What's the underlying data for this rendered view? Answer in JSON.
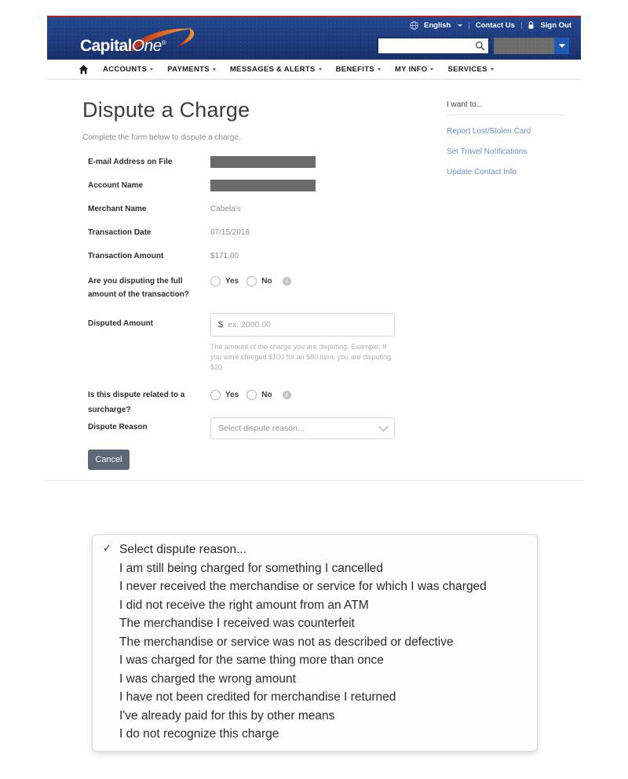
{
  "header": {
    "logo_text_1": "Capital",
    "logo_text_2": "One",
    "logo_reg": "®",
    "language": "English",
    "contact_us": "Contact Us",
    "sign_out": "Sign Out",
    "separator": "|",
    "search_placeholder": "",
    "search_value": "",
    "account_selector_value": ""
  },
  "nav": {
    "items": [
      {
        "label": "ACCOUNTS",
        "has_caret": true
      },
      {
        "label": "PAYMENTS",
        "has_caret": true
      },
      {
        "label": "MESSAGES & ALERTS",
        "has_caret": true
      },
      {
        "label": "BENEFITS",
        "has_caret": true
      },
      {
        "label": "MY INFO",
        "has_caret": true
      },
      {
        "label": "SERVICES",
        "has_caret": true
      }
    ]
  },
  "main": {
    "title": "Dispute a Charge",
    "subtitle": "Complete the form below to dispute a charge."
  },
  "i_want_to": {
    "title": "I want to...",
    "links": [
      "Report Lost/Stolen Card",
      "Set Travel Notifications",
      "Update Contact Info"
    ]
  },
  "form": {
    "email_label": "E-mail Address on File",
    "email_value": "",
    "account_name_label": "Account Name",
    "account_name_value": "",
    "merchant_label": "Merchant Name",
    "merchant_value": "Cabela's",
    "txn_date_label": "Transaction Date",
    "txn_date_value": "07/15/2016",
    "txn_amount_label": "Transaction Amount",
    "txn_amount_value": "$171.00",
    "full_amount_label": "Are you disputing the full amount of the transaction?",
    "yes_label": "Yes",
    "no_label": "No",
    "disputed_amount_label": "Disputed Amount",
    "disputed_amount_currency": "$",
    "disputed_amount_placeholder": "ex. 2000.00",
    "disputed_amount_value": "",
    "disputed_amount_help": "The amount of the charge you are disputing. Example: If you were charged $100 for an $80 item, you are disputing $20.",
    "surcharge_label": "Is this dispute related to a surcharge?",
    "dispute_reason_label": "Dispute Reason",
    "dispute_reason_selected": "Select dispute reason...",
    "cancel_label": "Cancel"
  },
  "dropdown": {
    "checkmark": "✓",
    "options": [
      {
        "label": "Select dispute reason...",
        "selected": true
      },
      {
        "label": "I am still being charged for something I cancelled",
        "selected": false
      },
      {
        "label": "I never received the merchandise or service for which I was charged",
        "selected": false
      },
      {
        "label": "I did not receive the right amount from an ATM",
        "selected": false
      },
      {
        "label": "The merchandise I received was counterfeit",
        "selected": false
      },
      {
        "label": "The merchandise or service was not as described or defective",
        "selected": false
      },
      {
        "label": "I was charged for the same thing more than once",
        "selected": false
      },
      {
        "label": "I was charged the wrong amount",
        "selected": false
      },
      {
        "label": "I have not been credited for merchandise I returned",
        "selected": false
      },
      {
        "label": "I've already paid for this by other means",
        "selected": false
      },
      {
        "label": "I do not recognize this charge",
        "selected": false
      }
    ]
  },
  "colors": {
    "header_blue": "#1e3d7f",
    "accent_red": "#b32017",
    "logo_swoosh": "#d8541f",
    "link_blue": "#6b8fc4",
    "button_slate": "#5c6876",
    "redact_gray": "#6b6b6b"
  }
}
